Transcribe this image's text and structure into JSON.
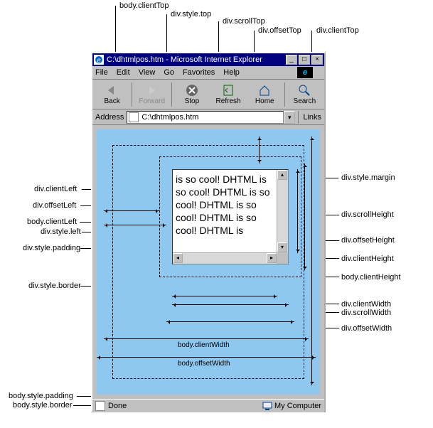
{
  "window": {
    "title": "C:\\dhtmlpos.htm - Microsoft Internet Explorer",
    "min": "_",
    "max": "□",
    "close": "×"
  },
  "menu": {
    "file": "File",
    "edit": "Edit",
    "view": "View",
    "go": "Go",
    "favorites": "Favorites",
    "help": "Help"
  },
  "toolbar": {
    "back": "Back",
    "forward": "Forward",
    "stop": "Stop",
    "refresh": "Refresh",
    "home": "Home",
    "search": "Search"
  },
  "address": {
    "label": "Address",
    "value": "C:\\dhtmlpos.htm",
    "links": "Links"
  },
  "content_text": "is so cool! DHTML is so cool! DHTML is so cool! DHTML is so cool! DHTML is so cool! DHTML is",
  "status": {
    "done": "Done",
    "zone": "My Computer"
  },
  "labels": {
    "top": {
      "body_clientTop": "body.clientTop",
      "div_style_top": "div.style.top",
      "div_scrollTop": "div.scrollTop",
      "div_offsetTop": "div.offsetTop",
      "div_clientTop": "div.clientTop"
    },
    "left": {
      "div_clientLeft": "div.clientLeft",
      "div_offsetLeft": "div.offsetLeft",
      "body_clientLeft": "body.clientLeft",
      "div_style_left": "div.style.left",
      "div_style_padding": "div.style.padding",
      "div_style_border": "div.style.border",
      "body_style_padding": "body.style.padding",
      "body_style_border": "body.style.border"
    },
    "right": {
      "div_style_margin": "div.style.margin",
      "div_scrollHeight": "div.scrollHeight",
      "div_offsetHeight": "div.offsetHeight",
      "div_clientHeight": "div.clientHeight",
      "body_clientHeight": "body.clientHeight",
      "div_clientWidth": "div.clientWidth",
      "div_scrollWidth": "div.scrollWidth",
      "div_offsetWidth": "div.offsetWidth"
    },
    "bottom": {
      "body_clientWidth": "body.clientWidth",
      "body_offsetWidth": "body.offsetWidth"
    }
  }
}
